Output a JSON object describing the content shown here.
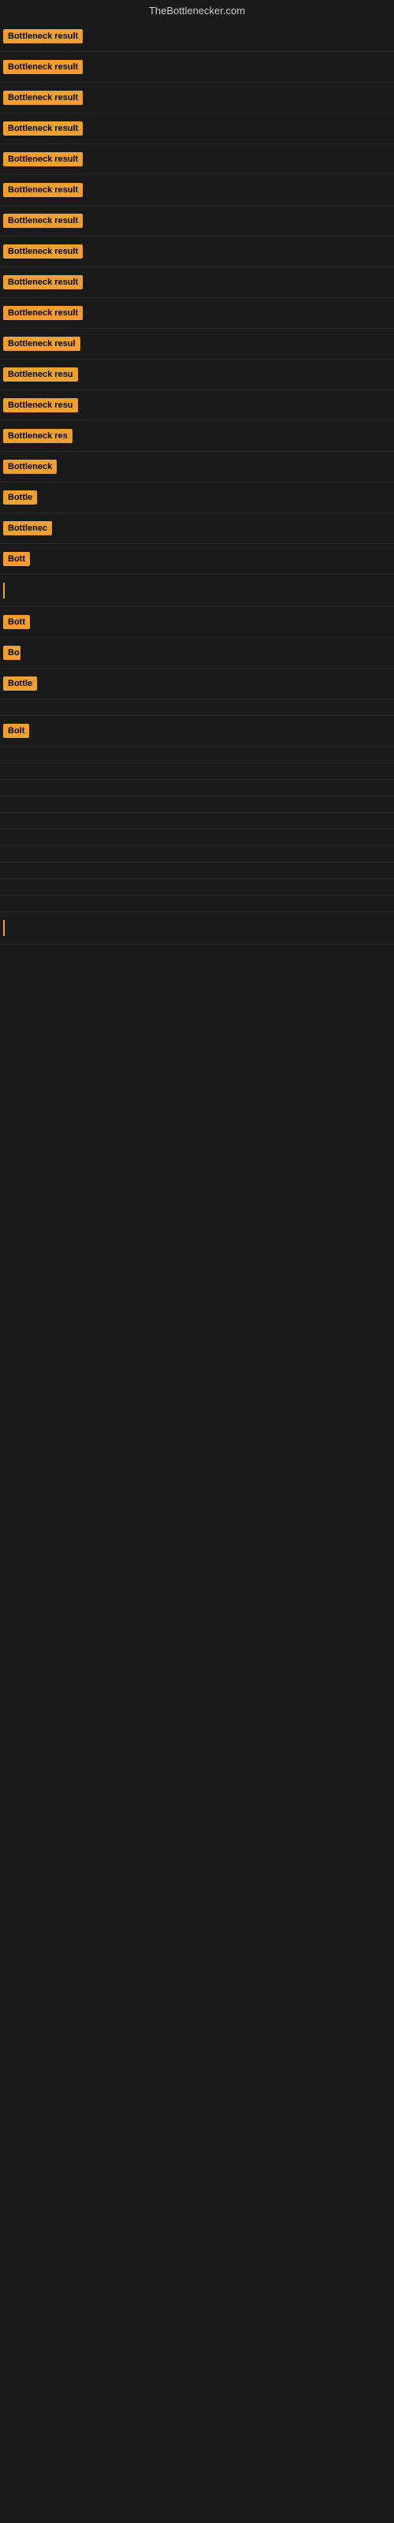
{
  "header": {
    "title": "TheBottlenecker.com"
  },
  "rows": [
    {
      "id": 1,
      "label": "Bottleneck result",
      "width": 155
    },
    {
      "id": 2,
      "label": "Bottleneck result",
      "width": 155
    },
    {
      "id": 3,
      "label": "Bottleneck result",
      "width": 155
    },
    {
      "id": 4,
      "label": "Bottleneck result",
      "width": 155
    },
    {
      "id": 5,
      "label": "Bottleneck result",
      "width": 155
    },
    {
      "id": 6,
      "label": "Bottleneck result",
      "width": 155
    },
    {
      "id": 7,
      "label": "Bottleneck result",
      "width": 155
    },
    {
      "id": 8,
      "label": "Bottleneck result",
      "width": 155
    },
    {
      "id": 9,
      "label": "Bottleneck result",
      "width": 155
    },
    {
      "id": 10,
      "label": "Bottleneck result",
      "width": 155
    },
    {
      "id": 11,
      "label": "Bottleneck resul",
      "width": 140
    },
    {
      "id": 12,
      "label": "Bottleneck resu",
      "width": 128
    },
    {
      "id": 13,
      "label": "Bottleneck resu",
      "width": 115
    },
    {
      "id": 14,
      "label": "Bottleneck res",
      "width": 100
    },
    {
      "id": 15,
      "label": "Bottleneck",
      "width": 82
    },
    {
      "id": 16,
      "label": "Bottle",
      "width": 52
    },
    {
      "id": 17,
      "label": "Bottlenec",
      "width": 72
    },
    {
      "id": 18,
      "label": "Bott",
      "width": 38
    },
    {
      "id": 19,
      "label": "",
      "width": 10,
      "cursor": true
    },
    {
      "id": 20,
      "label": "Bott",
      "width": 38
    },
    {
      "id": 21,
      "label": "Bo",
      "width": 22
    },
    {
      "id": 22,
      "label": "Bottle",
      "width": 52
    },
    {
      "id": 23,
      "label": "",
      "width": 0,
      "empty": true
    },
    {
      "id": 24,
      "label": "Bolt",
      "width": 34
    },
    {
      "id": 25,
      "label": "",
      "width": 0,
      "empty": true
    },
    {
      "id": 26,
      "label": "",
      "width": 0,
      "empty": true
    },
    {
      "id": 27,
      "label": "",
      "width": 0,
      "empty": true
    },
    {
      "id": 28,
      "label": "",
      "width": 0,
      "empty": true
    },
    {
      "id": 29,
      "label": "",
      "width": 0,
      "empty": true
    },
    {
      "id": 30,
      "label": "",
      "width": 0,
      "empty": true
    },
    {
      "id": 31,
      "label": "",
      "width": 0,
      "empty": true
    },
    {
      "id": 32,
      "label": "",
      "width": 0,
      "empty": true
    },
    {
      "id": 33,
      "label": "",
      "width": 0,
      "empty": true
    },
    {
      "id": 34,
      "label": "",
      "width": 0,
      "empty": true
    },
    {
      "id": 35,
      "label": "",
      "width": 0,
      "cursor2": true
    }
  ]
}
